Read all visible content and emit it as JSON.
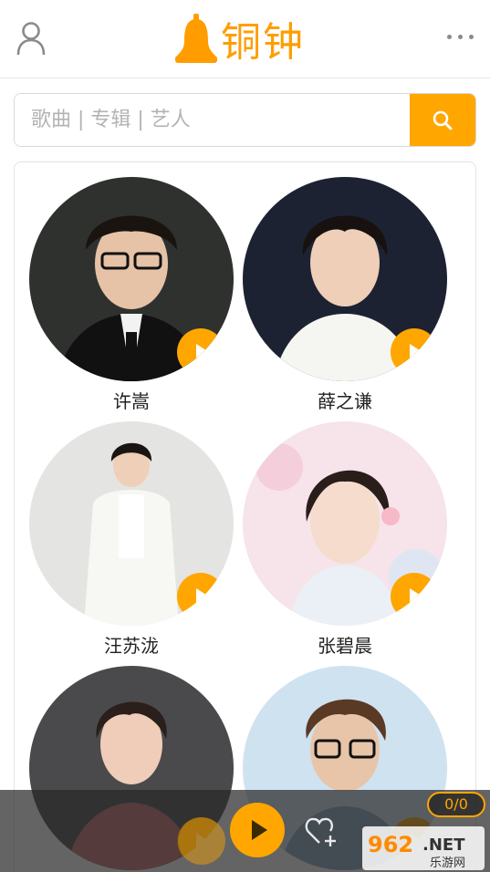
{
  "header": {
    "title": "铜钟",
    "user_icon": "user-icon",
    "more_icon": "more-dots-icon"
  },
  "search": {
    "placeholder": "歌曲 | 专辑 | 艺人",
    "button_icon": "search-icon"
  },
  "artists": [
    {
      "name": "许嵩"
    },
    {
      "name": "薛之谦"
    },
    {
      "name": "汪苏泷"
    },
    {
      "name": "张碧晨"
    },
    {
      "name": ""
    },
    {
      "name": ""
    }
  ],
  "player": {
    "queue_count": "0/0",
    "play_icon": "play-icon",
    "favorite_icon": "heart-plus-icon"
  },
  "watermark": {
    "number": "962",
    "suffix": ".NET",
    "caption": "乐游网"
  },
  "colors": {
    "accent": "#ffa600",
    "border": "#e3e3e3"
  }
}
